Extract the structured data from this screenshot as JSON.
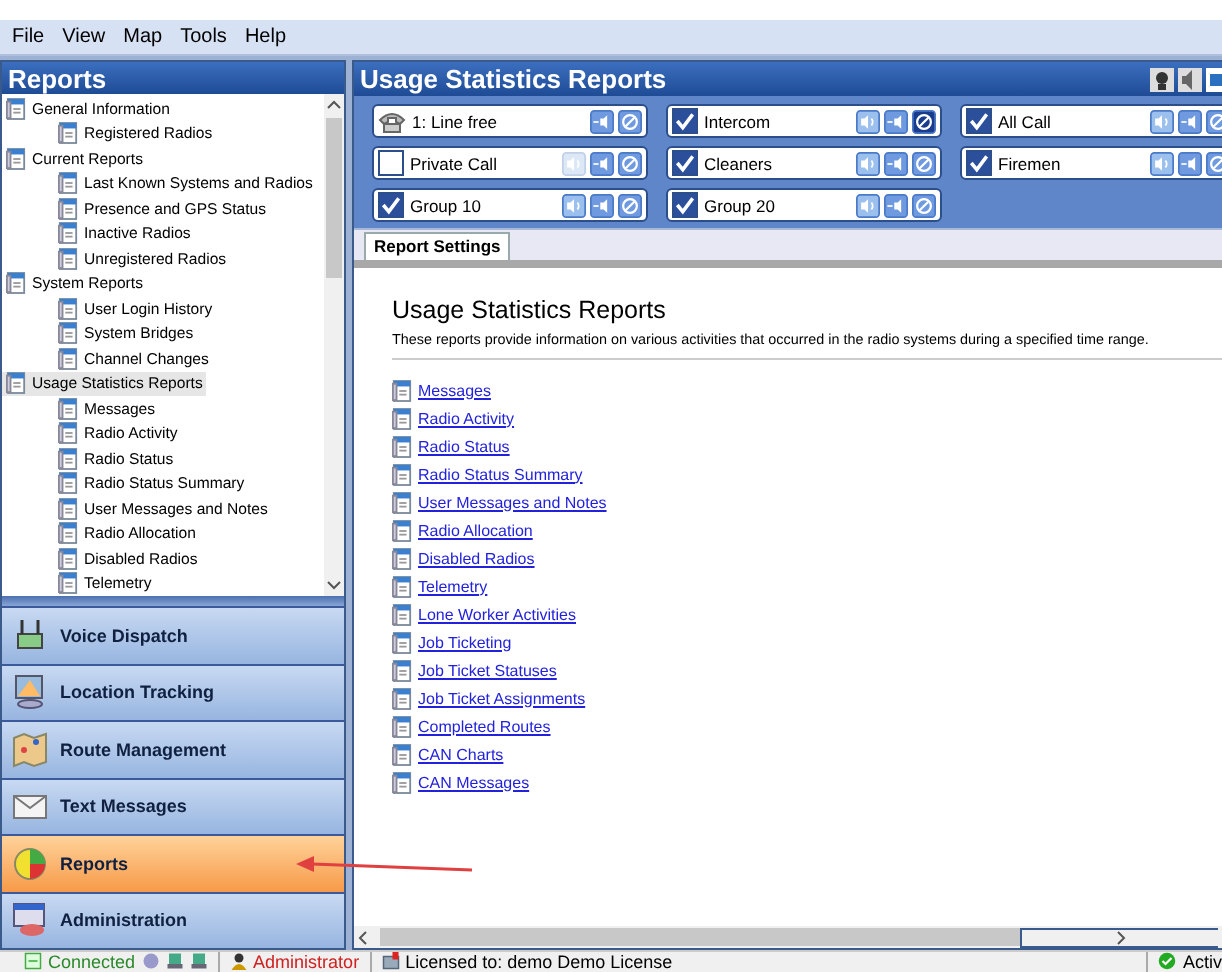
{
  "menu": [
    "File",
    "View",
    "Map",
    "Tools",
    "Help"
  ],
  "sidebar": {
    "title": "Reports",
    "tree": [
      {
        "label": "General Information",
        "selected": false,
        "children": [
          {
            "label": "Registered Radios",
            "selected": false
          }
        ]
      },
      {
        "label": "Current Reports",
        "selected": false,
        "children": [
          {
            "label": "Last Known Systems and Radios",
            "selected": false
          },
          {
            "label": "Presence and GPS Status",
            "selected": false
          },
          {
            "label": "Inactive Radios",
            "selected": false
          },
          {
            "label": "Unregistered Radios",
            "selected": false
          }
        ]
      },
      {
        "label": "System Reports",
        "selected": false,
        "children": [
          {
            "label": "User Login History",
            "selected": false
          },
          {
            "label": "System Bridges",
            "selected": false
          },
          {
            "label": "Channel Changes",
            "selected": false
          }
        ]
      },
      {
        "label": "Usage Statistics Reports",
        "selected": true,
        "children": [
          {
            "label": "Messages",
            "selected": false
          },
          {
            "label": "Radio Activity",
            "selected": false
          },
          {
            "label": "Radio Status",
            "selected": false
          },
          {
            "label": "Radio Status Summary",
            "selected": false
          },
          {
            "label": "User Messages and Notes",
            "selected": false
          },
          {
            "label": "Radio Allocation",
            "selected": false
          },
          {
            "label": "Disabled Radios",
            "selected": false
          },
          {
            "label": "Telemetry",
            "selected": false
          }
        ]
      }
    ],
    "nav": [
      {
        "label": "Voice Dispatch",
        "kind": "radio",
        "selected": false
      },
      {
        "label": "Location Tracking",
        "kind": "map",
        "selected": false
      },
      {
        "label": "Route Management",
        "kind": "route",
        "selected": false
      },
      {
        "label": "Text Messages",
        "kind": "mail",
        "selected": false
      },
      {
        "label": "Reports",
        "kind": "chart",
        "selected": true
      },
      {
        "label": "Administration",
        "kind": "admin",
        "selected": false
      }
    ]
  },
  "main": {
    "title": "Usage Statistics Reports",
    "channels": [
      {
        "kind": "line",
        "label": "1: Line free",
        "blocked": false
      },
      {
        "kind": "group",
        "label": "Intercom",
        "checked": true,
        "talk_enabled": true,
        "blocked": true
      },
      {
        "kind": "group",
        "label": "All Call",
        "checked": true,
        "talk_enabled": true,
        "blocked": false
      },
      {
        "kind": "group",
        "label": "Private Call",
        "checked": false,
        "talk_enabled": false,
        "blocked": false
      },
      {
        "kind": "group",
        "label": "Cleaners",
        "checked": true,
        "talk_enabled": true,
        "blocked": false
      },
      {
        "kind": "group",
        "label": "Firemen",
        "checked": true,
        "talk_enabled": true,
        "blocked": false
      },
      {
        "kind": "group",
        "label": "Group 10",
        "checked": true,
        "talk_enabled": true,
        "blocked": false
      },
      {
        "kind": "group",
        "label": "Group 20",
        "checked": true,
        "talk_enabled": true,
        "blocked": false
      }
    ],
    "tabs": [
      {
        "label": "Report Settings",
        "selected": true
      }
    ],
    "heading": "Usage Statistics Reports",
    "description": "These reports provide information on various activities that occurred in the radio systems during a specified time range.",
    "links": [
      "Messages",
      "Radio Activity",
      "Radio Status",
      "Radio Status Summary",
      "User Messages and Notes",
      "Radio Allocation",
      "Disabled Radios",
      "Telemetry",
      "Lone Worker Activities",
      "Job Ticketing",
      "Job Ticket Statuses",
      "Job Ticket Assignments",
      "Completed Routes",
      "CAN Charts",
      "CAN Messages"
    ]
  },
  "status_bar": {
    "connection": "Connected",
    "user": "Administrator",
    "license": "Licensed to: demo Demo License",
    "activity": "Activ"
  }
}
